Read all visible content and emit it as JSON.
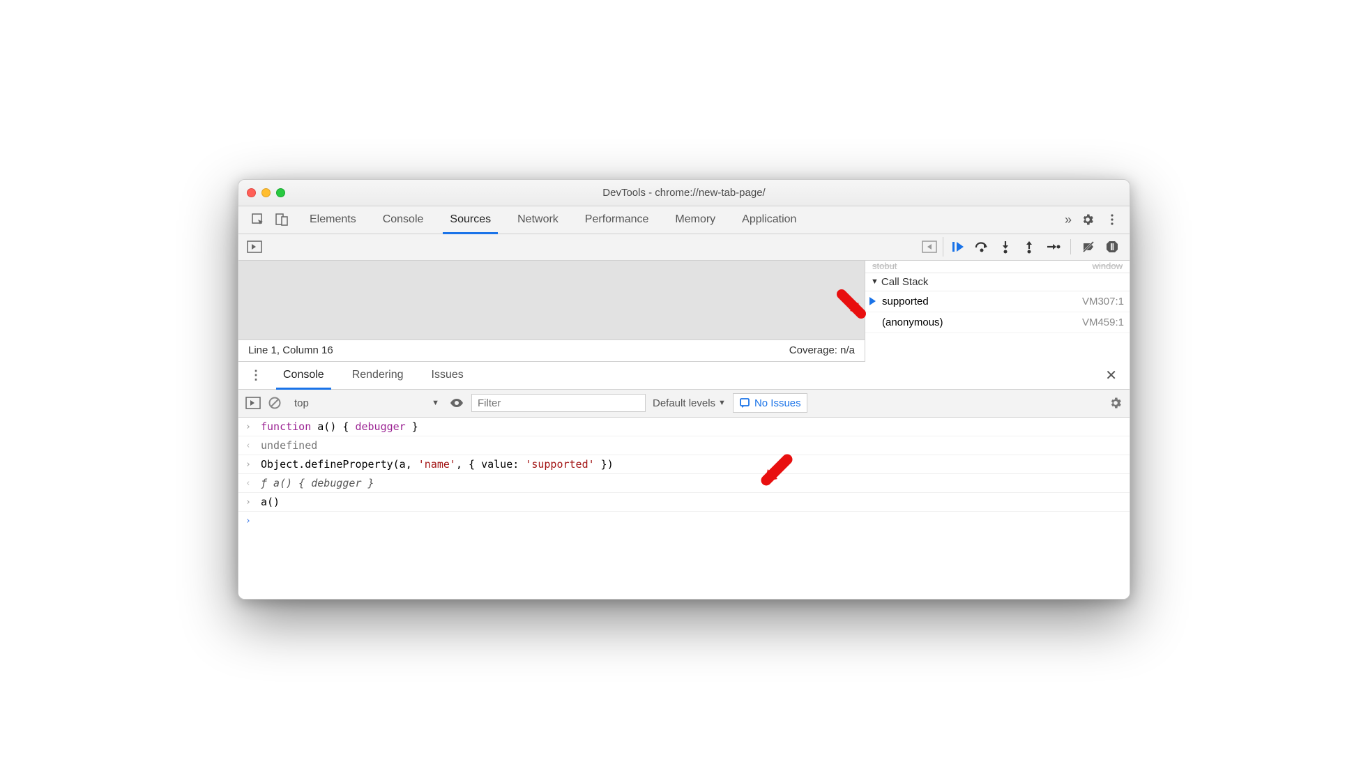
{
  "window": {
    "title": "DevTools - chrome://new-tab-page/"
  },
  "main_tabs": [
    "Elements",
    "Console",
    "Sources",
    "Network",
    "Performance",
    "Memory",
    "Application"
  ],
  "main_tab_active": "Sources",
  "source_status": {
    "position": "Line 1, Column 16",
    "coverage": "Coverage: n/a"
  },
  "callstack": {
    "header": "Call Stack",
    "items": [
      {
        "name": "supported",
        "loc": "VM307:1",
        "current": true
      },
      {
        "name": "(anonymous)",
        "loc": "VM459:1",
        "current": false
      }
    ]
  },
  "drawer_tabs": [
    "Console",
    "Rendering",
    "Issues"
  ],
  "drawer_tab_active": "Console",
  "console_toolbar": {
    "context": "top",
    "filter_placeholder": "Filter",
    "levels": "Default levels",
    "issues": "No Issues"
  },
  "console_lines": [
    {
      "type": "input",
      "tokens": [
        [
          "kw",
          "function"
        ],
        [
          "",
          " a() { "
        ],
        [
          "kw",
          "debugger"
        ],
        [
          "",
          " }"
        ]
      ]
    },
    {
      "type": "output",
      "tokens": [
        [
          "undef",
          "undefined"
        ]
      ]
    },
    {
      "type": "input",
      "tokens": [
        [
          "",
          "Object.defineProperty(a, "
        ],
        [
          "str",
          "'name'"
        ],
        [
          "",
          ", { value: "
        ],
        [
          "str",
          "'supported'"
        ],
        [
          "",
          " })"
        ]
      ]
    },
    {
      "type": "output",
      "tokens": [
        [
          "fitalic",
          "ƒ a() { debugger }"
        ]
      ]
    },
    {
      "type": "input",
      "tokens": [
        [
          "",
          "a()"
        ]
      ]
    },
    {
      "type": "prompt",
      "tokens": []
    }
  ]
}
